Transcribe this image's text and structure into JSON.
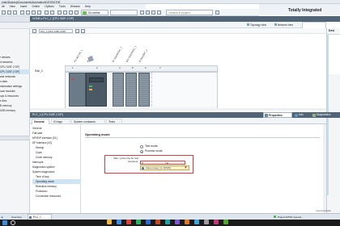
{
  "title_bar": {
    "path": "ersie\\Desktop\\Documents\\Automation\\DEVEN\\THE",
    "brand": "Totally Integrated"
  },
  "menu": [
    "dit",
    "View",
    "Insert",
    "Online",
    "Options",
    "Tools",
    "Window",
    "Help"
  ],
  "toolbar": {
    "go_online": "Go online",
    "search_placeholder": "<Search in project>"
  },
  "breadcrumb": {
    "part1": "HONE",
    "part2": "PLC_1 [CPU 315F-2 DP]"
  },
  "views": {
    "topology": "Topology view",
    "network": "Network view",
    "device_partial": "Devi"
  },
  "device_selector": "PLC_1 [CPU 315F-2 DP]",
  "sidebar_tree": [
    "r devices",
    "d networks",
    "CPU 315F-2 DP]",
    "CPU 315F-2 DP]",
    "and networks",
    "n data",
    "nformation settings",
    "ocal modules",
    "ups & resources",
    "e files",
    "B memory",
    "USB memory"
  ],
  "rack": {
    "label": "Rail_0",
    "slots": [
      "1",
      "2",
      "4",
      "5",
      "6",
      "7"
    ],
    "module_labels": [
      "PS 307 5A_1",
      "PLC_1",
      "DI 16x24VDC_1",
      "DO 16x24VDC_1",
      "AI 8x12BIT_1"
    ]
  },
  "device_header": "PLC_1 [CPU 315F-2 DP]",
  "prop_tabs": {
    "properties": "Properties",
    "info": "Info",
    "diagnostics": "Diagnostics"
  },
  "sub_tabs": {
    "general": "General",
    "io_tags": "IO tags",
    "system_constants": "System constants",
    "texts": "Texts"
  },
  "nav_items": [
    "General",
    "Fail-safe",
    "MPI/DP interface [X1]",
    "DP interface [X2]",
    "Startup",
    "Cycle",
    "Clock memory",
    "Interrupts",
    "Diagnostics system",
    "System diagnostics",
    "Time of day",
    "Operating mode",
    "Retentive memory",
    "Protection",
    "Connection resources"
  ],
  "operating_mode": {
    "section_title": "Operating mode",
    "test_mode": "Test mode",
    "process_mode": "Process mode",
    "max_cycle_label": "Max. cycle time for test functions:",
    "max_cycle_value": "0",
    "max_cycle_unit": "ms",
    "error_tooltip": "Value range: [1..65535]"
  },
  "left_bottom": {
    "details": "Details view",
    "portal": "Portal view",
    "overview": "Overview",
    "plc_tab": "PLC_1"
  },
  "status_right": {
    "project": "Project MTSP opened.",
    "instruments": "Instrumentatio"
  },
  "colors": {
    "title_bar": "#dfe6ee",
    "accent": "#1a8fc4",
    "header_dark": "#526577",
    "error_red": "#e23b3b",
    "taskbar": "#1b1b1b"
  }
}
